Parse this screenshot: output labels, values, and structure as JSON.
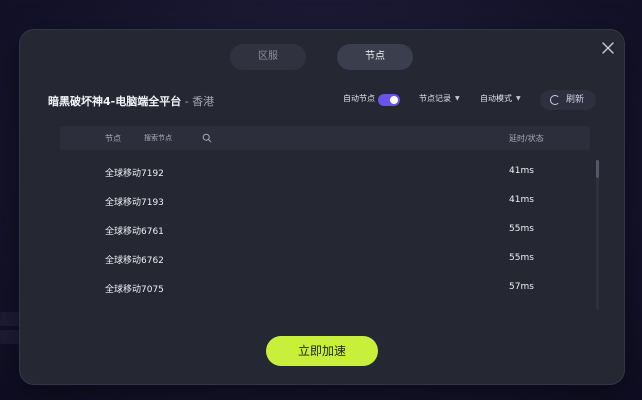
{
  "tabs": [
    {
      "label": "区服",
      "active": false
    },
    {
      "label": "节点",
      "active": true
    }
  ],
  "game": {
    "title": "暗黑破坏神4-电脑端全平台",
    "region": " - 香港"
  },
  "controls": {
    "auto_node_label": "自动节点",
    "auto_node_enabled": true,
    "node_history_label": "节点记录",
    "auto_mode_label": "自动模式",
    "refresh_label": "刷新"
  },
  "table": {
    "col_node": "节点",
    "search_placeholder": "搜索节点",
    "col_latency": "延时/状态",
    "rows": [
      {
        "name": "全球移动7192",
        "latency": "41ms"
      },
      {
        "name": "全球移动7193",
        "latency": "41ms"
      },
      {
        "name": "全球移动6761",
        "latency": "55ms"
      },
      {
        "name": "全球移动6762",
        "latency": "55ms"
      },
      {
        "name": "全球移动7075",
        "latency": "57ms"
      }
    ]
  },
  "accelerate_label": "立即加速",
  "colors": {
    "accent_purple": "#6b52e8",
    "accelerate_green": "#c8f03a",
    "modal_bg": "#252733"
  }
}
